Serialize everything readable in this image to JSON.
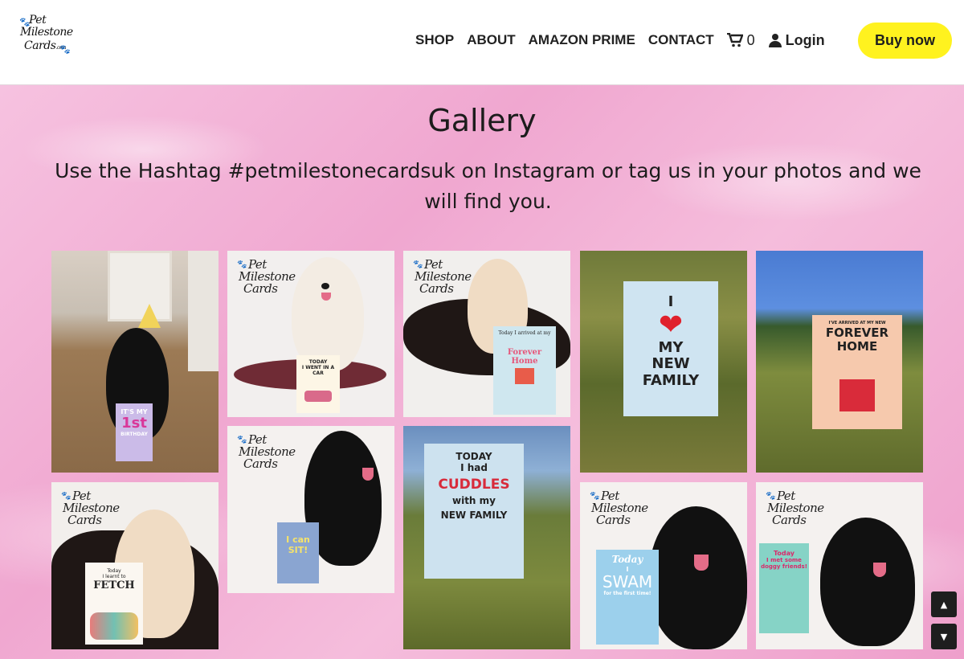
{
  "logo": {
    "line1": "Pet",
    "line2": "Milestone",
    "line3": "Cards",
    "line3_small": ".com"
  },
  "nav": {
    "shop": "SHOP",
    "about": "ABOUT",
    "amazon": "AMAZON PRIME",
    "contact": "CONTACT",
    "cart_count": "0",
    "login": "Login",
    "buy": "Buy now"
  },
  "page": {
    "title": "Gallery",
    "subtitle": "Use the Hashtag #petmilestonecardsuk on Instagram or tag us in your photos and we will find you."
  },
  "watermark": {
    "line1": "Pet",
    "line2": "Milestone",
    "line3": "Cards",
    "line3_small": ".com"
  },
  "tiles": {
    "t1": {
      "card_l1": "IT'S MY",
      "card_l2": "1st",
      "card_l3": "BIRTHDAY"
    },
    "t2": {
      "card_l1": "TODAY",
      "card_l2": "I WENT IN A CAR"
    },
    "t3": {
      "card_l1": "Today I arrived at my",
      "card_l2": "Forever Home"
    },
    "t4": {
      "card_l1": "I",
      "card_l2": "MY",
      "card_l3": "NEW",
      "card_l4": "FAMILY"
    },
    "t5": {
      "card_l1": "I'VE ARRIVED AT MY NEW",
      "card_l2": "FOREVER",
      "card_l3": "HOME"
    },
    "t6": {
      "card_l1": "I can",
      "card_l2": "SIT!"
    },
    "t7": {
      "card_l1": "TODAY",
      "card_l2": "I had",
      "card_l3": "CUDDLES",
      "card_l4": "with my",
      "card_l5": "NEW FAMILY"
    },
    "t8": {
      "card_l1": "Today",
      "card_l2": "I learnt to",
      "card_l3": "FETCH"
    },
    "t9": {
      "card_l1": "Today",
      "card_l2": "I",
      "card_l3": "SWAM",
      "card_l4": "for the first time!"
    },
    "t10": {
      "card_l1": "Today",
      "card_l2": "I met some doggy friends!"
    }
  },
  "colors": {
    "buy_button": "#fff21f",
    "background_pink": "#f4b9da",
    "header_bg": "#ffffff"
  },
  "icons": {
    "cart": "shopping-cart-icon",
    "user": "user-icon",
    "up": "chevron-up-icon",
    "down": "chevron-down-icon"
  }
}
